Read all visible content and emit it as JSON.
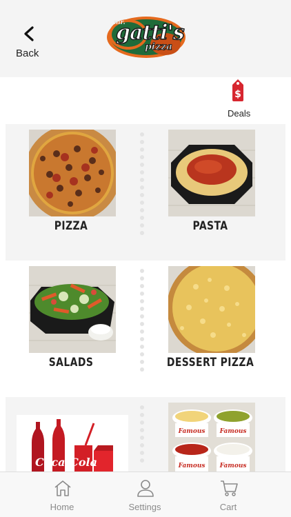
{
  "header": {
    "back_label": "Back",
    "logo_mr": "mr.",
    "logo_main": "gatti's",
    "logo_sub": "pizza"
  },
  "deals": {
    "label": "Deals",
    "icon": "price-tag-dollar-icon",
    "color": "#d7262f"
  },
  "menu": {
    "items": [
      {
        "label": "PIZZA",
        "image": "pizza-photo"
      },
      {
        "label": "PASTA",
        "image": "pasta-photo"
      },
      {
        "label": "SALADS",
        "image": "salad-photo"
      },
      {
        "label": "DESSERT PIZZA",
        "image": "dessert-pizza-photo"
      },
      {
        "label": "",
        "image": "drinks-photo"
      },
      {
        "label": "",
        "image": "sauces-photo"
      }
    ]
  },
  "tabbar": {
    "items": [
      {
        "label": "Home",
        "icon": "home-icon"
      },
      {
        "label": "Settings",
        "icon": "person-icon"
      },
      {
        "label": "Cart",
        "icon": "cart-icon"
      }
    ]
  },
  "colors": {
    "header_bg": "#f4f4f4",
    "row_shade": "#f4f4f4",
    "accent": "#d7262f",
    "logo_green": "#1f6b3a",
    "logo_orange": "#e56a1e"
  }
}
